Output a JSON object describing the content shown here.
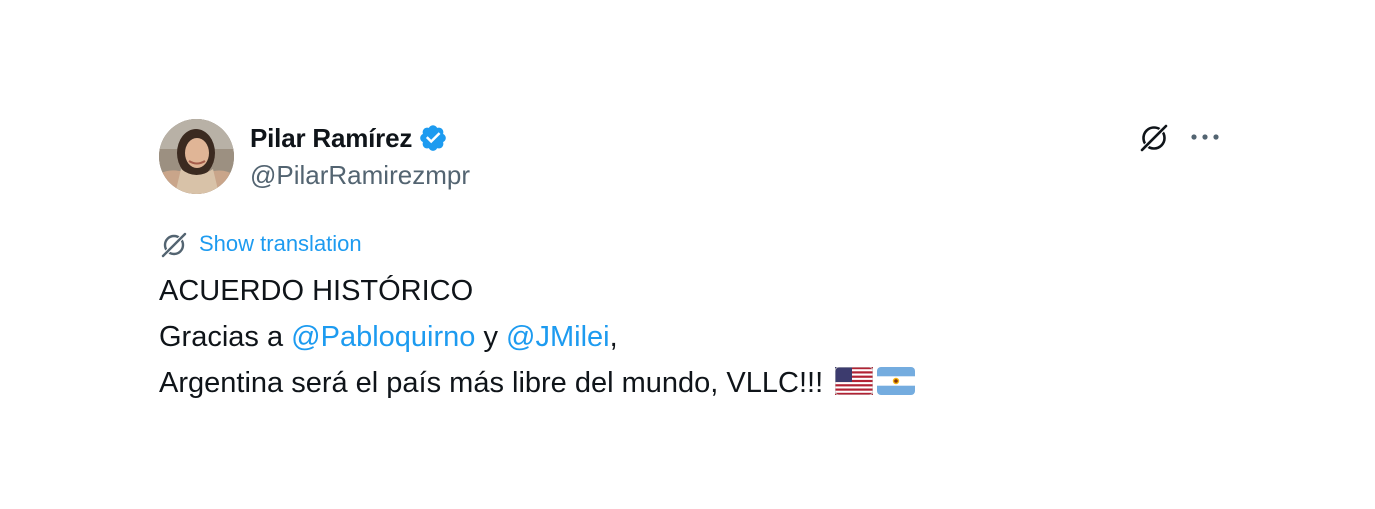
{
  "author": {
    "display_name": "Pilar Ramírez",
    "handle": "@PilarRamirezmpr",
    "verified": true,
    "avatar_icon": "profile-photo"
  },
  "actions": {
    "grok_icon": "grok-icon",
    "more_icon": "more-options-icon"
  },
  "translation": {
    "label": "Show translation",
    "icon": "translate-icon"
  },
  "body": {
    "line1": "ACUERDO HISTÓRICO",
    "line2": {
      "prefix": "Gracias a ",
      "mention1": "@Pabloquirno",
      "middle": " y ",
      "mention2": "@JMilei",
      "suffix": ","
    },
    "line3": {
      "text": "Argentina será el país más libre del mundo, VLLC!!! ",
      "emojis": [
        "us-flag",
        "argentina-flag"
      ]
    }
  },
  "colors": {
    "text": "#0f1419",
    "secondary": "#536471",
    "link": "#1d9bf0",
    "verified": "#1d9bf0"
  }
}
